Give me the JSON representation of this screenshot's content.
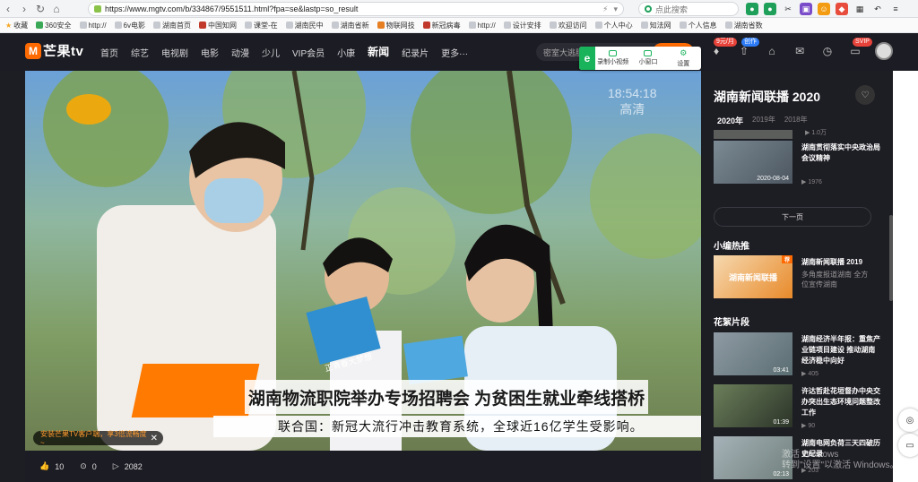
{
  "browser": {
    "url": "https://www.mgtv.com/b/334867/9551511.html?fpa=se&lastp=so_result",
    "search_placeholder": "点此搜索",
    "bookmarks": [
      "收藏",
      "360安全",
      "http://",
      "6v电影",
      "湖南首页",
      "中国知网",
      "课堂-在",
      "湖南民中",
      "湖南省新",
      "物联网技",
      "新冠病毒",
      "http://",
      "设计安排",
      "欢迎访问",
      "个人中心",
      "知法网",
      "个人信息",
      "湖南省数"
    ]
  },
  "site": {
    "logo_text": "芒果tv",
    "nav": [
      "首页",
      "综艺",
      "电视剧",
      "电影",
      "动漫",
      "少儿",
      "VIP会员",
      "小康",
      "新闻",
      "纪录片",
      "更多···"
    ],
    "active_nav": "新闻",
    "search_placeholder": "密室大逃脱",
    "float_toolbar": [
      "录制小视频",
      "小窗口",
      "设置"
    ],
    "badge_vip_price": "9元/月",
    "badge_creator": "创作",
    "badge_svip": "SVIP"
  },
  "video": {
    "timestamp_line1": "18:54:18",
    "timestamp_line2": "高清",
    "subtitle_main": "湖南物流职院举办专场招聘会 为贫困生就业牵线搭桥",
    "subtitle_ticker": "联合国：新冠大流行冲击教育系统，全球近16亿学生受影响。",
    "book_text": "正青春大梦想",
    "promo": "安装芒果TV客户端，享3倍流畅度 ~",
    "likes": "10",
    "comments": "0",
    "shares": "2082"
  },
  "sidebar": {
    "title": "湖南新闻联播 2020",
    "years": [
      "2020年",
      "2019年",
      "2018年"
    ],
    "top_views": "1.0万",
    "episode": {
      "title": "湖南贯彻落实中央政治局会议精神",
      "thumb_date": "2020-08-04",
      "views": "1976"
    },
    "next_label": "下一页",
    "section_hot": "小编热推",
    "hot": {
      "title": "湖南新闻联播 2019",
      "sub": "多角度报道湖南 全方位宣传湖南",
      "thumb_text": "湖南新闻联播",
      "tag": "荐"
    },
    "section_clips": "花絮片段",
    "clips": [
      {
        "title": "湖南经济半年报：重焦产业链项目建设 推动湖南经济稳中向好",
        "dur": "03:41",
        "views": "405"
      },
      {
        "title": "许达哲赴花垣督办中央交办突出生态环境问题整改工作",
        "dur": "01:39",
        "views": "90"
      },
      {
        "title": "湖南电网负荷三天四破历史纪录",
        "dur": "02:13",
        "views": "203"
      }
    ]
  },
  "os": {
    "activate_line1": "激活 Windows",
    "activate_line2": "转到\"设置\"以激活 Windows。"
  }
}
